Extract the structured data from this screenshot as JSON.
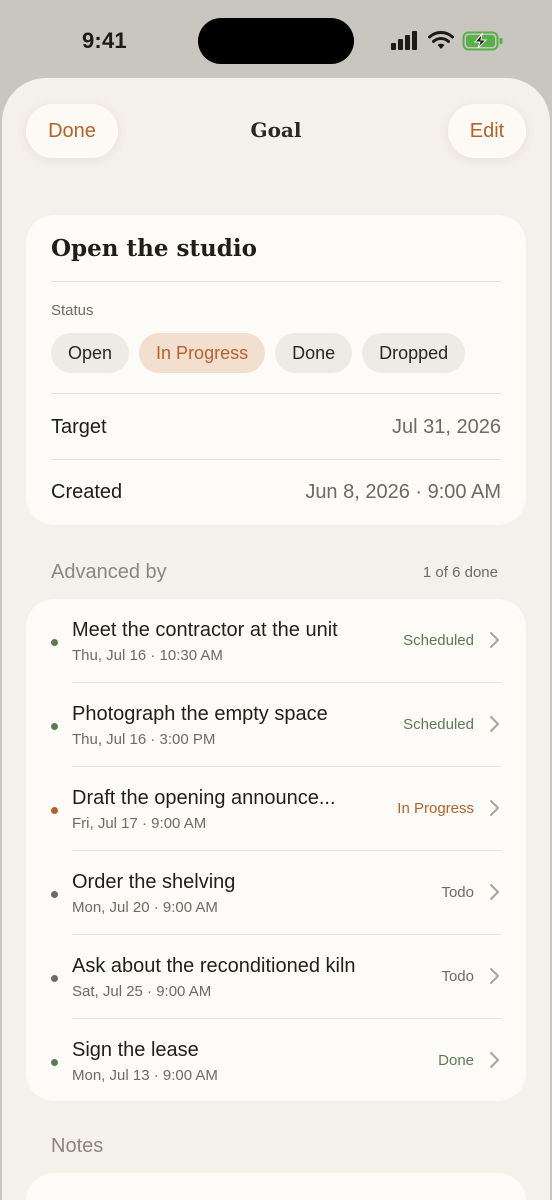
{
  "status_bar": {
    "time": "9:41"
  },
  "nav": {
    "done_label": "Done",
    "title": "Goal",
    "edit_label": "Edit"
  },
  "goal": {
    "title": "Open the studio",
    "status_label": "Status",
    "status_options": [
      "Open",
      "In Progress",
      "Done",
      "Dropped"
    ],
    "selected_status": "In Progress",
    "target_label": "Target",
    "target_value": "Jul 31, 2026",
    "created_label": "Created",
    "created_value": "Jun 8, 2026 · 9:00 AM"
  },
  "advanced_by": {
    "header": "Advanced by",
    "count": "1 of 6 done",
    "items": [
      {
        "title": "Meet the contractor at the unit",
        "when": "Thu, Jul 16 · 10:30 AM",
        "status": "Scheduled",
        "color": "#5e7a55"
      },
      {
        "title": "Photograph the empty space",
        "when": "Thu, Jul 16 · 3:00 PM",
        "status": "Scheduled",
        "color": "#5e7a55"
      },
      {
        "title": "Draft the opening announce...",
        "when": "Fri, Jul 17 · 9:00 AM",
        "status": "In Progress",
        "color": "#b5622a"
      },
      {
        "title": "Order the shelving",
        "when": "Mon, Jul 20 · 9:00 AM",
        "status": "Todo",
        "color": "#6f6a63"
      },
      {
        "title": "Ask about the reconditioned kiln",
        "when": "Sat, Jul 25 · 9:00 AM",
        "status": "Todo",
        "color": "#6f6a63"
      },
      {
        "title": "Sign the lease",
        "when": "Mon, Jul 13 · 9:00 AM",
        "status": "Done",
        "color": "#5e7a55"
      }
    ]
  },
  "notes": {
    "header": "Notes"
  },
  "colors": {
    "accent": "#b5622a",
    "scheduled": "#5e7a55",
    "muted": "#6f6a63",
    "background": "#f4f0ea"
  }
}
